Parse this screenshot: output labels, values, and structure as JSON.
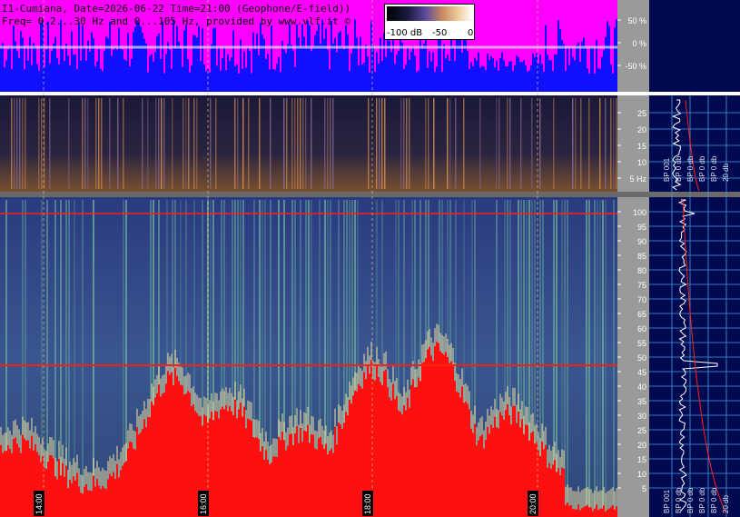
{
  "header": {
    "line1": "I1-Cumiana, Date=2026-06-22 Time=21:00 (Geophone/E-field))",
    "line2": "Freq= 0.2...30 Hz and 0...105 Hz, provided by www.vlf.it ©"
  },
  "colorbar": {
    "min_label": "-100 dB",
    "mid_label": "-50",
    "max_label": "0"
  },
  "top_panel": {
    "ticks": [
      "50 %",
      "0 %",
      "-50 %"
    ]
  },
  "mid_panel": {
    "ticks": [
      "25",
      "20",
      "15",
      "10",
      "5 Hz"
    ],
    "side_labels": [
      "BP 001",
      "BP 0 db",
      "BP 0 db",
      "BP 0 db",
      "BP 0 db",
      "20 db"
    ]
  },
  "bottom_panel": {
    "ticks": [
      "100",
      "95",
      "90",
      "85",
      "80",
      "75",
      "70",
      "65",
      "60",
      "55",
      "50",
      "45",
      "40",
      "35",
      "30",
      "25",
      "20",
      "15",
      "10",
      "5"
    ],
    "side_labels": [
      "BP 001",
      "BP 0 db",
      "BP 0 db",
      "BP 0 db",
      "BP 0 db",
      "20 db"
    ],
    "time_labels": [
      "14:00",
      "16:00",
      "18:00",
      "20:00"
    ]
  },
  "colors": {
    "top_bg": "#ff00ff",
    "top_fill": "#1010ff",
    "spectrum_bg": "#18204a",
    "right_panel": "#000850",
    "line_50hz": "#ff2010",
    "grid": "#3aa0e0"
  }
}
